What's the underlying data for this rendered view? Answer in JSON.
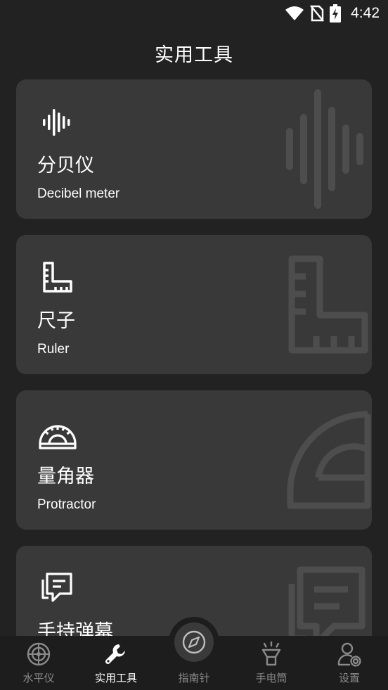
{
  "status": {
    "time": "4:42"
  },
  "page": {
    "title": "实用工具"
  },
  "cards": [
    {
      "title_zh": "分贝仪",
      "title_en": "Decibel meter",
      "icon": "sound-wave-icon"
    },
    {
      "title_zh": "尺子",
      "title_en": "Ruler",
      "icon": "ruler-icon"
    },
    {
      "title_zh": "量角器",
      "title_en": "Protractor",
      "icon": "protractor-icon"
    },
    {
      "title_zh": "手持弹幕",
      "title_en": "",
      "icon": "chat-bubble-icon"
    }
  ],
  "nav": {
    "items": [
      {
        "label": "水平仪",
        "icon": "level-icon"
      },
      {
        "label": "实用工具",
        "icon": "wrench-icon",
        "active": true
      },
      {
        "label": "指南针",
        "icon": "compass-icon"
      },
      {
        "label": "手电筒",
        "icon": "flashlight-icon"
      },
      {
        "label": "设置",
        "icon": "user-settings-icon"
      }
    ]
  },
  "colors": {
    "background": "#222222",
    "card": "#393939",
    "navbar": "#1d1d1d",
    "inactive": "#8a8a8a",
    "active": "#ffffff"
  }
}
